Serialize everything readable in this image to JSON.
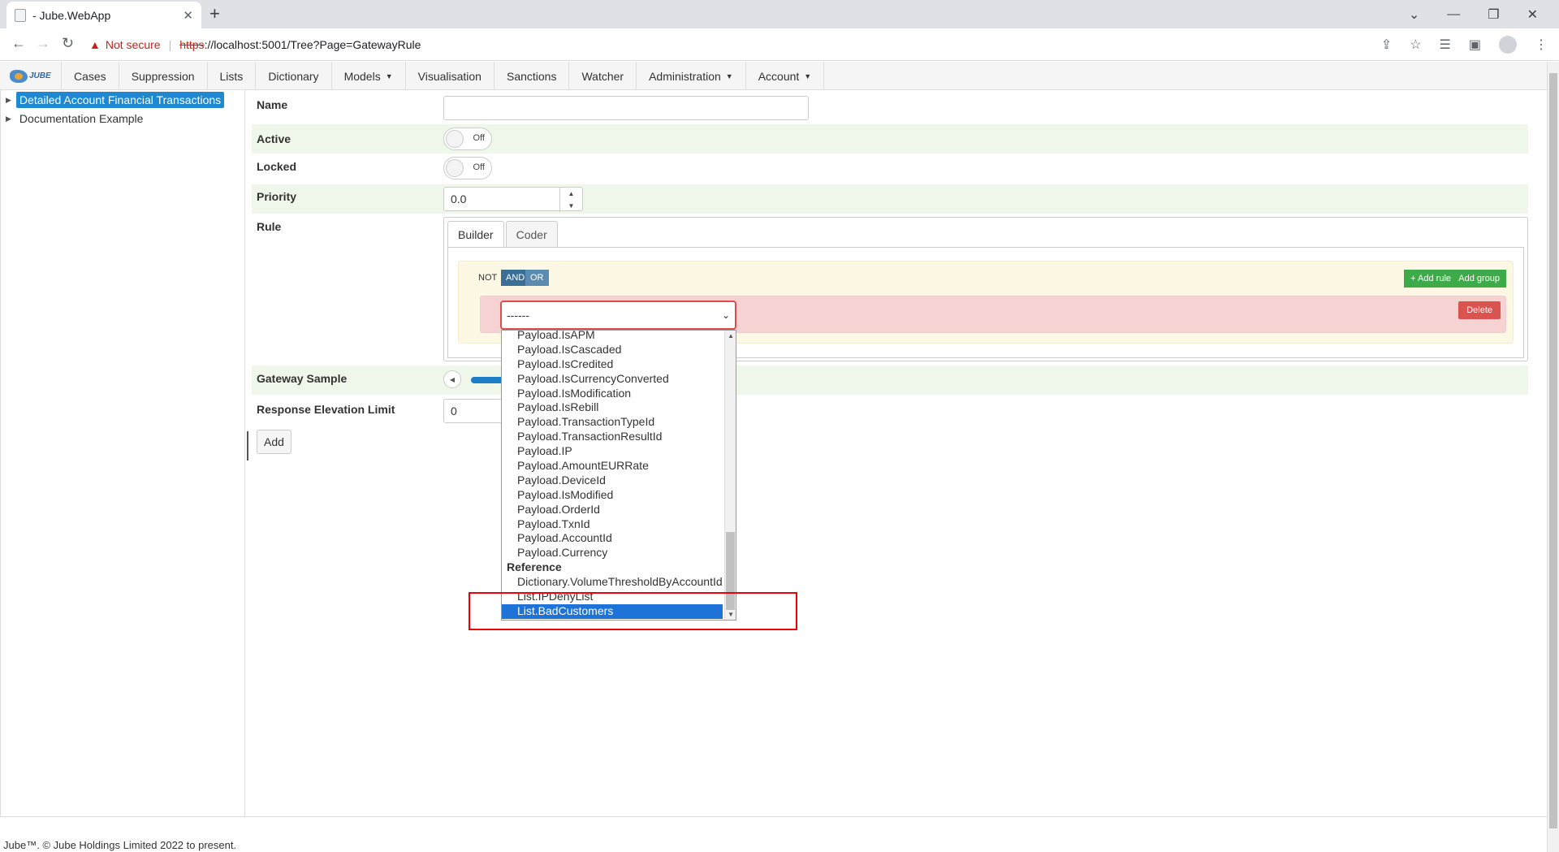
{
  "browser": {
    "tab_title": "- Jube.WebApp",
    "tab_close": "✕",
    "new_tab": "+",
    "security_label": "Not secure",
    "url_scheme": "https",
    "url_rest": "://localhost:5001/Tree?Page=GatewayRule",
    "window_minimize": "⌄"
  },
  "menu": {
    "logo_text": "JUBE",
    "items": [
      {
        "label": "Cases"
      },
      {
        "label": "Suppression"
      },
      {
        "label": "Lists"
      },
      {
        "label": "Dictionary"
      },
      {
        "label": "Models",
        "dropdown": true
      },
      {
        "label": "Visualisation"
      },
      {
        "label": "Sanctions"
      },
      {
        "label": "Watcher"
      },
      {
        "label": "Administration",
        "dropdown": true
      },
      {
        "label": "Account",
        "dropdown": true
      }
    ]
  },
  "tree": {
    "items": [
      {
        "label": "Detailed Account Financial Transactions",
        "selected": true
      },
      {
        "label": "Documentation Example",
        "selected": false
      }
    ]
  },
  "form": {
    "name_label": "Name",
    "name_value": "",
    "active_label": "Active",
    "active_state": "Off",
    "locked_label": "Locked",
    "locked_state": "Off",
    "priority_label": "Priority",
    "priority_value": "0.0",
    "rule_label": "Rule",
    "tab_builder": "Builder",
    "tab_coder": "Coder",
    "not_label": "NOT",
    "and_label": "AND",
    "or_label": "OR",
    "add_rule_label": "+ Add rule",
    "add_group_label": "Add group",
    "delete_label": "Delete",
    "field_select_value": "------",
    "gateway_sample_label": "Gateway Sample",
    "response_elevation_label": "Response Elevation Limit",
    "response_elevation_value": "0",
    "add_button": "Add"
  },
  "dropdown": {
    "payload_options": [
      "Payload.IsAPM",
      "Payload.IsCascaded",
      "Payload.IsCredited",
      "Payload.IsCurrencyConverted",
      "Payload.IsModification",
      "Payload.IsRebill",
      "Payload.TransactionTypeId",
      "Payload.TransactionResultId",
      "Payload.IP",
      "Payload.AmountEURRate",
      "Payload.DeviceId",
      "Payload.IsModified",
      "Payload.OrderId",
      "Payload.TxnId",
      "Payload.AccountId",
      "Payload.Currency"
    ],
    "reference_group": "Reference",
    "reference_options": [
      "Dictionary.VolumeThresholdByAccountId",
      "List.IPDenyList",
      "List.BadCustomers"
    ],
    "highlighted": "List.BadCustomers"
  },
  "footer": {
    "text": "Jube™. © Jube Holdings Limited 2022 to present."
  },
  "colors": {
    "accent": "#1c89d1",
    "green": "#3dab48",
    "danger": "#d9534f",
    "highlight_box": "#e00000"
  }
}
